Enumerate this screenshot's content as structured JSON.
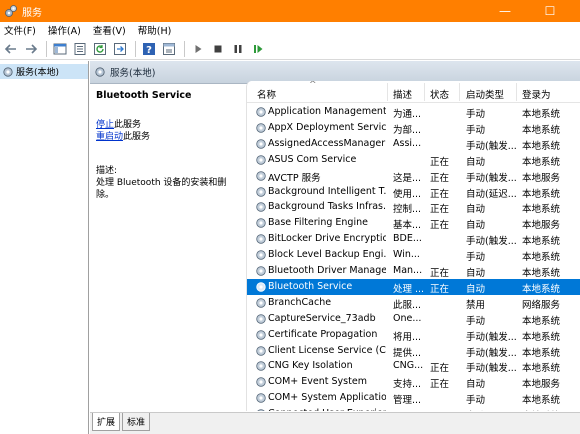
{
  "window": {
    "title": "服务",
    "minimize_glyph": "—",
    "maximize_glyph": "☐",
    "icon": "services-gear-icon"
  },
  "menu": [
    "文件(F)",
    "操作(A)",
    "查看(V)",
    "帮助(H)"
  ],
  "toolbar": {
    "icons": [
      "back-arrow-icon",
      "forward-arrow-icon",
      "console-tree-icon",
      "properties-icon",
      "refresh-icon",
      "export-list-icon",
      "help-icon",
      "show-hide-icon",
      "start-service-icon",
      "stop-service-icon",
      "pause-service-icon",
      "restart-service-icon"
    ]
  },
  "tree": {
    "root_label": "服务(本地)"
  },
  "panel": {
    "header_title": "服务(本地)"
  },
  "description": {
    "service_name": "Bluetooth Service",
    "stop_link": "停止",
    "stop_suffix": "此服务",
    "restart_link": "重启动",
    "restart_suffix": "此服务",
    "desc_label": "描述:",
    "desc_text": "处理 Bluetooth 设备的安装和删除。"
  },
  "columns": [
    "名称",
    "描述",
    "状态",
    "启动类型",
    "登录为"
  ],
  "services": [
    {
      "name": "Application Management",
      "desc": "为通...",
      "status": "",
      "startup": "手动",
      "logon": "本地系统"
    },
    {
      "name": "AppX Deployment Servic...",
      "desc": "为部...",
      "status": "",
      "startup": "手动",
      "logon": "本地系统"
    },
    {
      "name": "AssignedAccessManager",
      "desc": "Assi...",
      "status": "",
      "startup": "手动(触发...",
      "logon": "本地系统"
    },
    {
      "name": "ASUS Com Service",
      "desc": "",
      "status": "正在",
      "startup": "自动",
      "logon": "本地系统"
    },
    {
      "name": "AVCTP 服务",
      "desc": "这是...",
      "status": "正在",
      "startup": "手动(触发...",
      "logon": "本地服务"
    },
    {
      "name": "Background Intelligent T...",
      "desc": "使用...",
      "status": "正在",
      "startup": "自动(延迟...",
      "logon": "本地系统"
    },
    {
      "name": "Background Tasks Infras...",
      "desc": "控制...",
      "status": "正在",
      "startup": "自动",
      "logon": "本地系统"
    },
    {
      "name": "Base Filtering Engine",
      "desc": "基本...",
      "status": "正在",
      "startup": "自动",
      "logon": "本地服务"
    },
    {
      "name": "BitLocker Drive Encryptio...",
      "desc": "BDE...",
      "status": "",
      "startup": "手动(触发...",
      "logon": "本地系统"
    },
    {
      "name": "Block Level Backup Engi...",
      "desc": "Win...",
      "status": "",
      "startup": "手动",
      "logon": "本地系统"
    },
    {
      "name": "Bluetooth Driver Manage...",
      "desc": "Man...",
      "status": "正在",
      "startup": "自动",
      "logon": "本地系统"
    },
    {
      "name": "Bluetooth Service",
      "desc": "处理 ...",
      "status": "正在",
      "startup": "自动",
      "logon": "本地系统",
      "selected": true
    },
    {
      "name": "BranchCache",
      "desc": "此服...",
      "status": "",
      "startup": "禁用",
      "logon": "网络服务"
    },
    {
      "name": "CaptureService_73adb",
      "desc": "One...",
      "status": "",
      "startup": "手动",
      "logon": "本地系统"
    },
    {
      "name": "Certificate Propagation",
      "desc": "将用...",
      "status": "",
      "startup": "手动(触发...",
      "logon": "本地系统"
    },
    {
      "name": "Client License Service (Cli...",
      "desc": "提供...",
      "status": "",
      "startup": "手动(触发...",
      "logon": "本地系统"
    },
    {
      "name": "CNG Key Isolation",
      "desc": "CNG...",
      "status": "正在",
      "startup": "手动(触发...",
      "logon": "本地系统"
    },
    {
      "name": "COM+ Event System",
      "desc": "支持...",
      "status": "正在",
      "startup": "自动",
      "logon": "本地服务"
    },
    {
      "name": "COM+ System Application",
      "desc": "管理...",
      "status": "",
      "startup": "手动",
      "logon": "本地系统"
    },
    {
      "name": "Connected User Experien...",
      "desc": "",
      "status": "",
      "startup": "自动",
      "logon": "本地系统"
    }
  ],
  "tabs": [
    "扩展",
    "标准"
  ]
}
